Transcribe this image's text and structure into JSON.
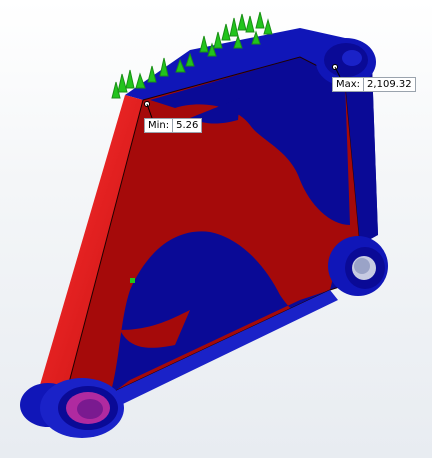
{
  "model": {
    "colors": {
      "high_stress": "#a50a0a",
      "low_stress": "#0a0a96",
      "edge_highlight": "#ff2020",
      "mid_blue": "#1a22c8",
      "fixture_green": "#22c41c",
      "hole_magenta": "#b02aa0"
    }
  },
  "probes": {
    "min": {
      "tag": "Min:",
      "value": "5.26"
    },
    "max": {
      "tag": "Max:",
      "value": "2,109.32"
    }
  }
}
